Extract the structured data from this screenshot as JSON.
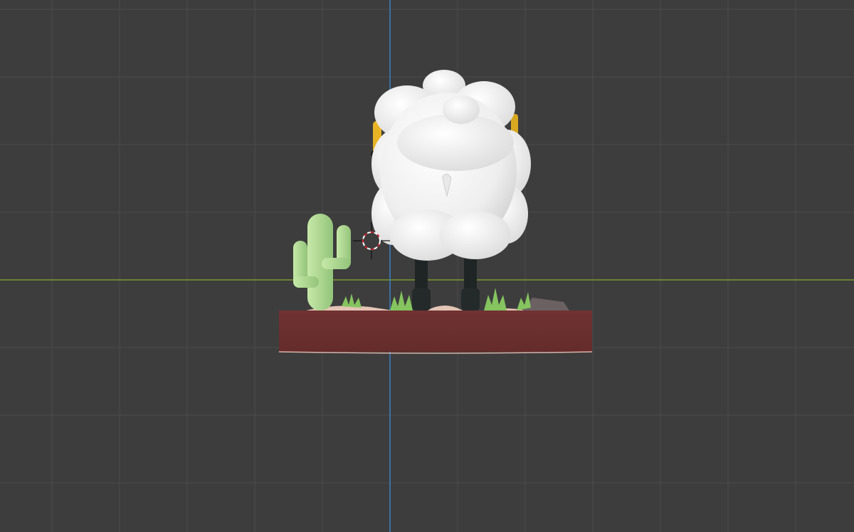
{
  "viewport": {
    "background_color": "#3d3d3d",
    "grid_color": "#4f4f4f",
    "x_axis_color": "#7f9a2f",
    "z_axis_color": "#3f7fc0",
    "grid_visible": true
  },
  "scene": {
    "objects": [
      {
        "name": "sheep-body",
        "material_color": "#f2f2f2"
      },
      {
        "name": "sheep-legs",
        "material_color": "#1f2424"
      },
      {
        "name": "sheep-side-accent",
        "material_color": "#e8b324"
      },
      {
        "name": "cactus",
        "material_color": "#a8d48a"
      },
      {
        "name": "grass-tufts",
        "material_color": "#7fbf5a"
      },
      {
        "name": "rock",
        "material_color": "#6a5f60"
      },
      {
        "name": "sand-patches",
        "material_color": "#e2c2b3"
      },
      {
        "name": "ground-base",
        "material_color": "#6b2f2f"
      }
    ],
    "cursor_icon": "3d-cursor-icon"
  }
}
